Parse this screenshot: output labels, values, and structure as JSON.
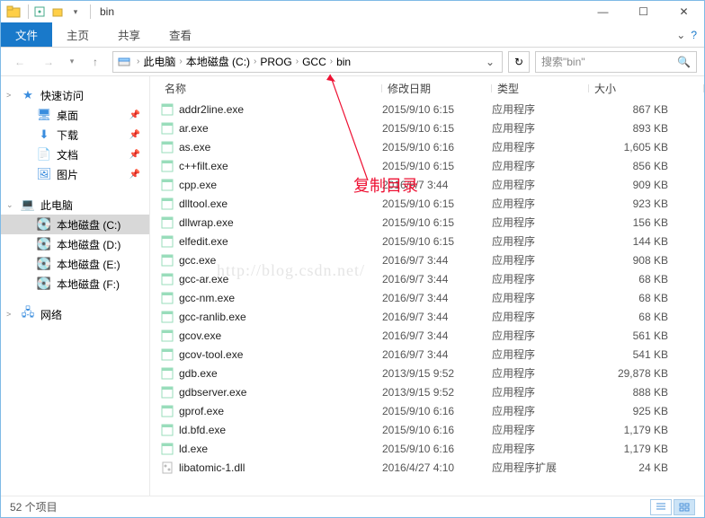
{
  "window": {
    "title": "bin",
    "min": "—",
    "max": "☐",
    "close": "✕"
  },
  "ribbon": {
    "file": "文件",
    "home": "主页",
    "share": "共享",
    "view": "查看"
  },
  "breadcrumbs": {
    "pc": "此电脑",
    "disk": "本地磁盘 (C:)",
    "prog": "PROG",
    "gcc": "GCC",
    "bin": "bin"
  },
  "search": {
    "placeholder": "搜索\"bin\""
  },
  "sidebar": {
    "quick": "快速访问",
    "desktop": "桌面",
    "downloads": "下载",
    "documents": "文档",
    "pictures": "图片",
    "thispc": "此电脑",
    "c": "本地磁盘 (C:)",
    "d": "本地磁盘 (D:)",
    "e": "本地磁盘 (E:)",
    "f": "本地磁盘 (F:)",
    "network": "网络"
  },
  "columns": {
    "name": "名称",
    "date": "修改日期",
    "type": "类型",
    "size": "大小"
  },
  "types": {
    "app": "应用程序",
    "ext": "应用程序扩展"
  },
  "files": [
    {
      "n": "addr2line.exe",
      "d": "2015/9/10 6:15",
      "t": "app",
      "s": "867 KB"
    },
    {
      "n": "ar.exe",
      "d": "2015/9/10 6:15",
      "t": "app",
      "s": "893 KB"
    },
    {
      "n": "as.exe",
      "d": "2015/9/10 6:16",
      "t": "app",
      "s": "1,605 KB"
    },
    {
      "n": "c++filt.exe",
      "d": "2015/9/10 6:15",
      "t": "app",
      "s": "856 KB"
    },
    {
      "n": "cpp.exe",
      "d": "2016/9/7 3:44",
      "t": "app",
      "s": "909 KB"
    },
    {
      "n": "dlltool.exe",
      "d": "2015/9/10 6:15",
      "t": "app",
      "s": "923 KB"
    },
    {
      "n": "dllwrap.exe",
      "d": "2015/9/10 6:15",
      "t": "app",
      "s": "156 KB"
    },
    {
      "n": "elfedit.exe",
      "d": "2015/9/10 6:15",
      "t": "app",
      "s": "144 KB"
    },
    {
      "n": "gcc.exe",
      "d": "2016/9/7 3:44",
      "t": "app",
      "s": "908 KB"
    },
    {
      "n": "gcc-ar.exe",
      "d": "2016/9/7 3:44",
      "t": "app",
      "s": "68 KB"
    },
    {
      "n": "gcc-nm.exe",
      "d": "2016/9/7 3:44",
      "t": "app",
      "s": "68 KB"
    },
    {
      "n": "gcc-ranlib.exe",
      "d": "2016/9/7 3:44",
      "t": "app",
      "s": "68 KB"
    },
    {
      "n": "gcov.exe",
      "d": "2016/9/7 3:44",
      "t": "app",
      "s": "561 KB"
    },
    {
      "n": "gcov-tool.exe",
      "d": "2016/9/7 3:44",
      "t": "app",
      "s": "541 KB"
    },
    {
      "n": "gdb.exe",
      "d": "2013/9/15 9:52",
      "t": "app",
      "s": "29,878 KB"
    },
    {
      "n": "gdbserver.exe",
      "d": "2013/9/15 9:52",
      "t": "app",
      "s": "888 KB"
    },
    {
      "n": "gprof.exe",
      "d": "2015/9/10 6:16",
      "t": "app",
      "s": "925 KB"
    },
    {
      "n": "ld.bfd.exe",
      "d": "2015/9/10 6:16",
      "t": "app",
      "s": "1,179 KB"
    },
    {
      "n": "ld.exe",
      "d": "2015/9/10 6:16",
      "t": "app",
      "s": "1,179 KB"
    },
    {
      "n": "libatomic-1.dll",
      "d": "2016/4/27 4:10",
      "t": "ext",
      "s": "24 KB"
    }
  ],
  "status": {
    "items": "52 个项目"
  },
  "annotation": {
    "text": "复制目录"
  },
  "watermark": {
    "text": "http://blog.csdn.net/"
  }
}
